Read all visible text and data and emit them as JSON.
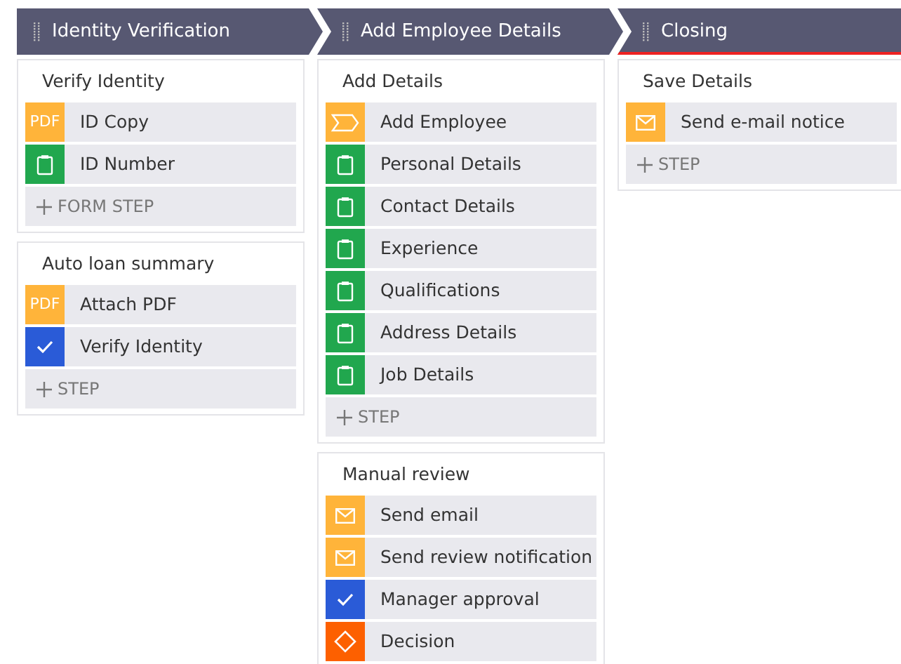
{
  "stages": [
    {
      "title": "Identity Verification",
      "selected": false,
      "processes": [
        {
          "title": "Verify Identity",
          "steps": [
            {
              "kind": "pdf",
              "icon_text": "PDF",
              "label": "ID Copy"
            },
            {
              "kind": "form",
              "label": "ID Number"
            }
          ],
          "add_label": "FORM STEP"
        },
        {
          "title": "Auto loan summary",
          "steps": [
            {
              "kind": "pdf",
              "icon_text": "PDF",
              "label": "Attach PDF"
            },
            {
              "kind": "approval",
              "label": "Verify Identity"
            }
          ],
          "add_label": "STEP"
        }
      ]
    },
    {
      "title": "Add Employee Details",
      "selected": false,
      "processes": [
        {
          "title": "Add Details",
          "steps": [
            {
              "kind": "subprocess",
              "label": "Add Employee"
            },
            {
              "kind": "form",
              "label": "Personal Details"
            },
            {
              "kind": "form",
              "label": "Contact Details"
            },
            {
              "kind": "form",
              "label": "Experience"
            },
            {
              "kind": "form",
              "label": "Qualifications"
            },
            {
              "kind": "form",
              "label": "Address Details"
            },
            {
              "kind": "form",
              "label": "Job Details"
            }
          ],
          "add_label": "STEP"
        },
        {
          "title": "Manual review",
          "steps": [
            {
              "kind": "email",
              "label": "Send email"
            },
            {
              "kind": "email",
              "label": "Send review notification"
            },
            {
              "kind": "approval",
              "label": "Manager approval"
            },
            {
              "kind": "decision",
              "label": "Decision"
            }
          ]
        }
      ]
    },
    {
      "title": "Closing",
      "selected": true,
      "processes": [
        {
          "title": "Save Details",
          "steps": [
            {
              "kind": "email",
              "label": "Send e-mail notice"
            }
          ],
          "add_label": "STEP"
        }
      ]
    }
  ]
}
